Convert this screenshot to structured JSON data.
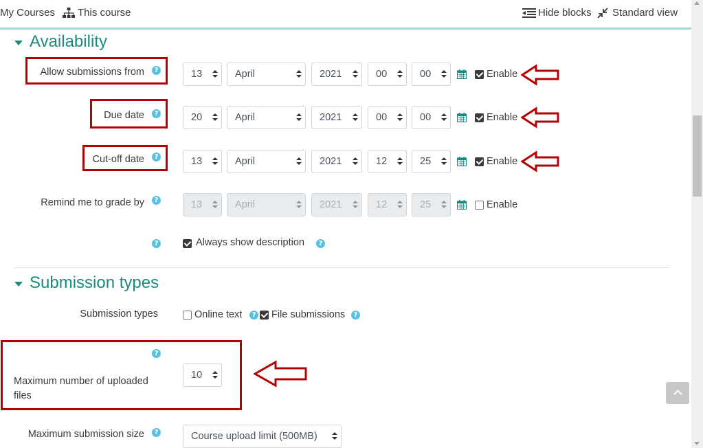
{
  "topnav": {
    "my_courses": "My Courses",
    "this_course": "This course",
    "hide_blocks": "Hide blocks",
    "standard_view": "Standard view"
  },
  "availability": {
    "title": "Availability",
    "rows": [
      {
        "label": "Allow submissions from",
        "day": "13",
        "month": "April",
        "year": "2021",
        "hour": "00",
        "minute": "00",
        "enable_label": "Enable",
        "enabled": true
      },
      {
        "label": "Due date",
        "day": "20",
        "month": "April",
        "year": "2021",
        "hour": "00",
        "minute": "00",
        "enable_label": "Enable",
        "enabled": true
      },
      {
        "label": "Cut-off date",
        "day": "13",
        "month": "April",
        "year": "2021",
        "hour": "12",
        "minute": "25",
        "enable_label": "Enable",
        "enabled": true
      },
      {
        "label": "Remind me to grade by",
        "day": "13",
        "month": "April",
        "year": "2021",
        "hour": "12",
        "minute": "25",
        "enable_label": "Enable",
        "enabled": false
      }
    ],
    "always_show_description": "Always show description"
  },
  "submission_types": {
    "title": "Submission types",
    "label": "Submission types",
    "online_text": "Online text",
    "file_submissions": "File submissions",
    "max_files_label_line1": "Maximum number of uploaded",
    "max_files_label_line2": "files",
    "max_files_value": "10",
    "max_size_label": "Maximum submission size",
    "max_size_value": "Course upload limit (500MB)"
  },
  "help_glyph": "?",
  "colors": {
    "accent": "#1a8a7f",
    "help": "#5bc0de",
    "annotation": "#b30000"
  }
}
